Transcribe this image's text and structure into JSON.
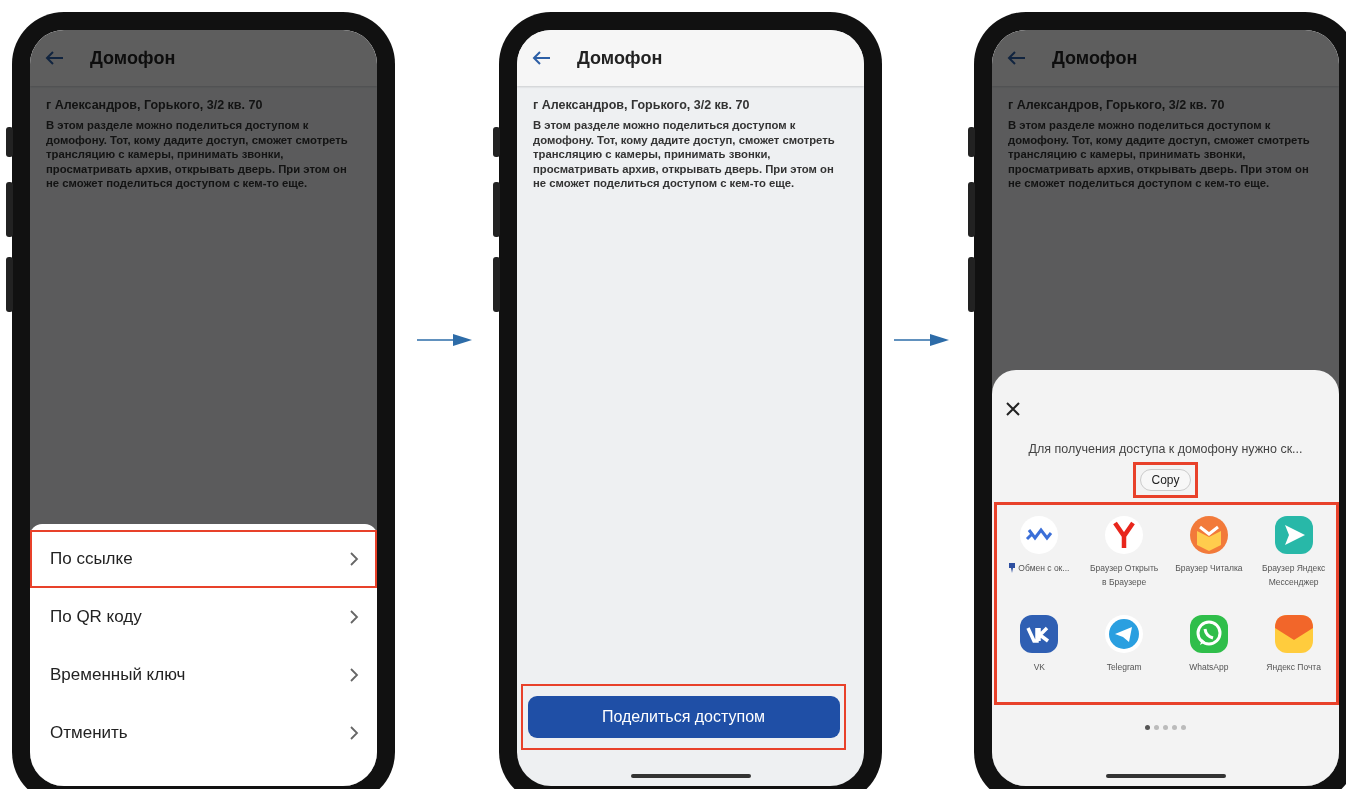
{
  "screens": [
    {
      "kind": "menu",
      "dimmed": true,
      "title": "Домофон",
      "address": "г Александров, Горького, 3/2 кв. 70",
      "description": "В этом разделе можно поделиться доступом к домофону. Тот, кому дадите доступ, сможет смотреть трансляцию с камеры, принимать звонки, просматривать архив, открывать дверь. При этом он не сможет поделиться доступом с кем-то еще.",
      "menu": [
        {
          "label": "По ссылке",
          "highlighted": true
        },
        {
          "label": "По QR коду",
          "highlighted": false
        },
        {
          "label": "Временный ключ",
          "highlighted": false
        },
        {
          "label": "Отменить",
          "highlighted": false
        }
      ]
    },
    {
      "kind": "share-button",
      "dimmed": false,
      "title": "Домофон",
      "address": "г Александров, Горького, 3/2 кв. 70",
      "description": "В этом разделе можно поделиться доступом к домофону. Тот, кому дадите доступ, сможет смотреть трансляцию с камеры, принимать звонки, просматривать архив, открывать дверь. При этом он не сможет поделиться доступом с кем-то еще.",
      "button": {
        "label": "Поделиться доступом",
        "highlighted": true
      }
    },
    {
      "kind": "share-sheet",
      "dimmed": true,
      "title": "Домофон",
      "address": "г Александров, Горького, 3/2 кв. 70",
      "description": "В этом разделе можно поделиться доступом к домофону. Тот, кому дадите доступ, сможет смотреть трансляцию с камеры, принимать звонки, просматривать архив, открывать дверь. При этом он не сможет поделиться доступом с кем-то еще.",
      "share_text": "Для получения доступа к домофону нужно ск...",
      "copy": {
        "label": "Copy",
        "highlighted": true
      },
      "apps_highlighted": true,
      "apps": [
        {
          "label": "Обмен с ок...",
          "pinned": true
        },
        {
          "label": "Браузер Открыть в Браузере",
          "pinned": false
        },
        {
          "label": "Браузер Читалка",
          "pinned": false
        },
        {
          "label": "Браузер Яндекс Мессенджер",
          "pinned": false
        },
        {
          "label": "VK",
          "pinned": false
        },
        {
          "label": "Telegram",
          "pinned": false
        },
        {
          "label": "WhatsApp",
          "pinned": false
        },
        {
          "label": "Яндекс Почта",
          "pinned": false
        }
      ],
      "pager": [
        {
          "selected": true
        },
        {
          "selected": false
        },
        {
          "selected": false
        },
        {
          "selected": false
        },
        {
          "selected": false
        }
      ]
    }
  ]
}
